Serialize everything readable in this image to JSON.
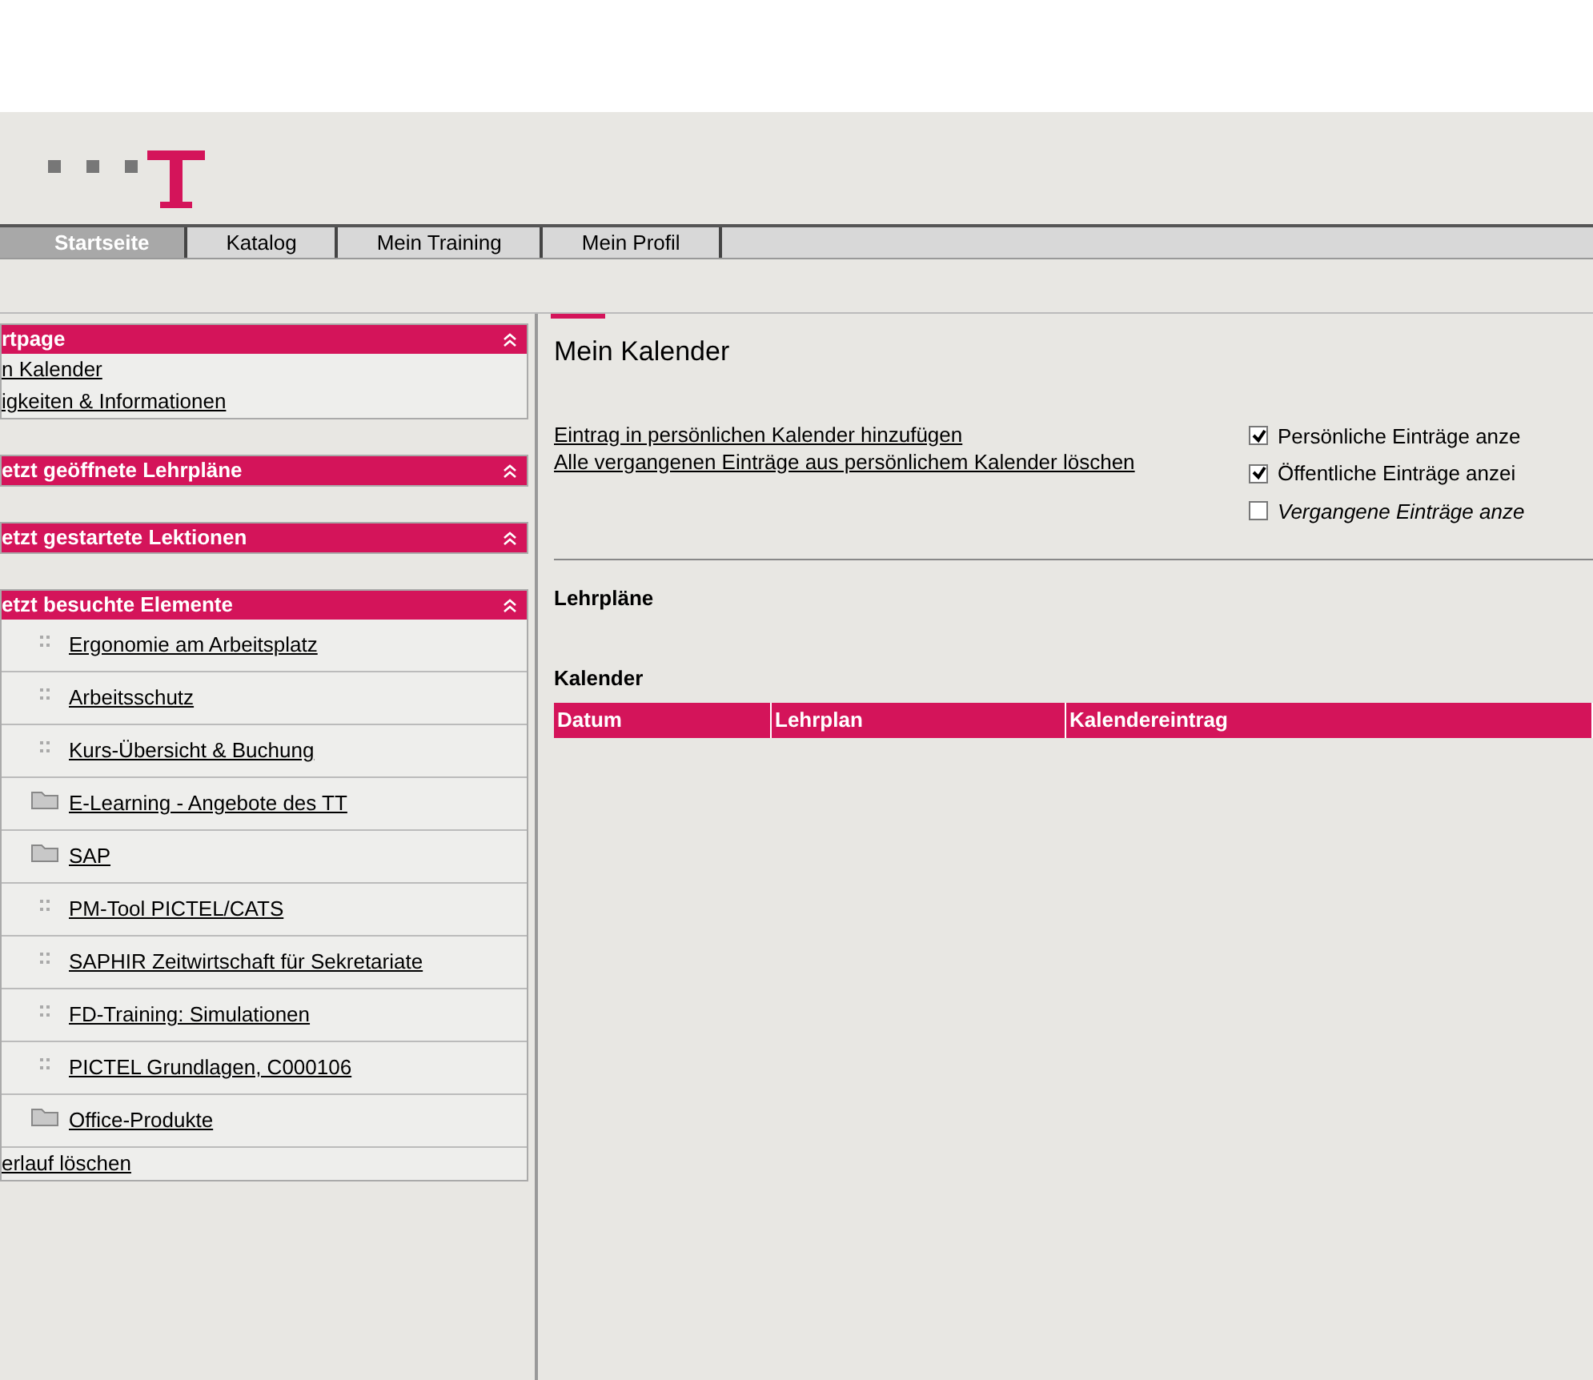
{
  "tabs": [
    {
      "label": "Startseite",
      "selected": true
    },
    {
      "label": "Katalog",
      "selected": false
    },
    {
      "label": "Mein Training",
      "selected": false
    },
    {
      "label": "Mein Profil",
      "selected": false
    }
  ],
  "sidebar": {
    "panels": [
      {
        "title": "rtpage",
        "expanded": true,
        "items": [
          {
            "label": "n Kalender",
            "kind": "plain"
          },
          {
            "label": "igkeiten & Informationen",
            "kind": "plain"
          }
        ]
      },
      {
        "title": "etzt geöffnete Lehrpläne",
        "expanded": true
      },
      {
        "title": "etzt gestartete Lektionen",
        "expanded": true
      },
      {
        "title": "etzt besuchte Elemente",
        "expanded": true,
        "items": [
          {
            "label": "Ergonomie am Arbeitsplatz",
            "kind": "document"
          },
          {
            "label": "Arbeitsschutz",
            "kind": "document"
          },
          {
            "label": "Kurs-Übersicht & Buchung",
            "kind": "document"
          },
          {
            "label": "E-Learning - Angebote des TT",
            "kind": "folder"
          },
          {
            "label": "SAP",
            "kind": "folder"
          },
          {
            "label": "PM-Tool PICTEL/CATS",
            "kind": "document"
          },
          {
            "label": "SAPHIR Zeitwirtschaft für Sekretariate",
            "kind": "document"
          },
          {
            "label": "FD-Training: Simulationen",
            "kind": "document"
          },
          {
            "label": "PICTEL Grundlagen, C000106",
            "kind": "document"
          },
          {
            "label": "Office-Produkte",
            "kind": "folder"
          },
          {
            "label": "erlauf löschen",
            "kind": "plain"
          }
        ]
      }
    ]
  },
  "main": {
    "title": "Mein Kalender",
    "links": [
      "Eintrag in persönlichen Kalender hinzufügen",
      "Alle vergangenen Einträge aus persönlichem Kalender löschen"
    ],
    "options": [
      {
        "label": "Persönliche Einträge anze",
        "checked": true,
        "italic": false
      },
      {
        "label": "Öffentliche Einträge anzei",
        "checked": true,
        "italic": false
      },
      {
        "label": "Vergangene Einträge anze",
        "checked": false,
        "italic": true
      }
    ],
    "section_1": "Lehrpläne",
    "section_2": "Kalender",
    "table": {
      "columns": [
        "Datum",
        "Lehrplan",
        "Kalendereintrag"
      ]
    }
  }
}
